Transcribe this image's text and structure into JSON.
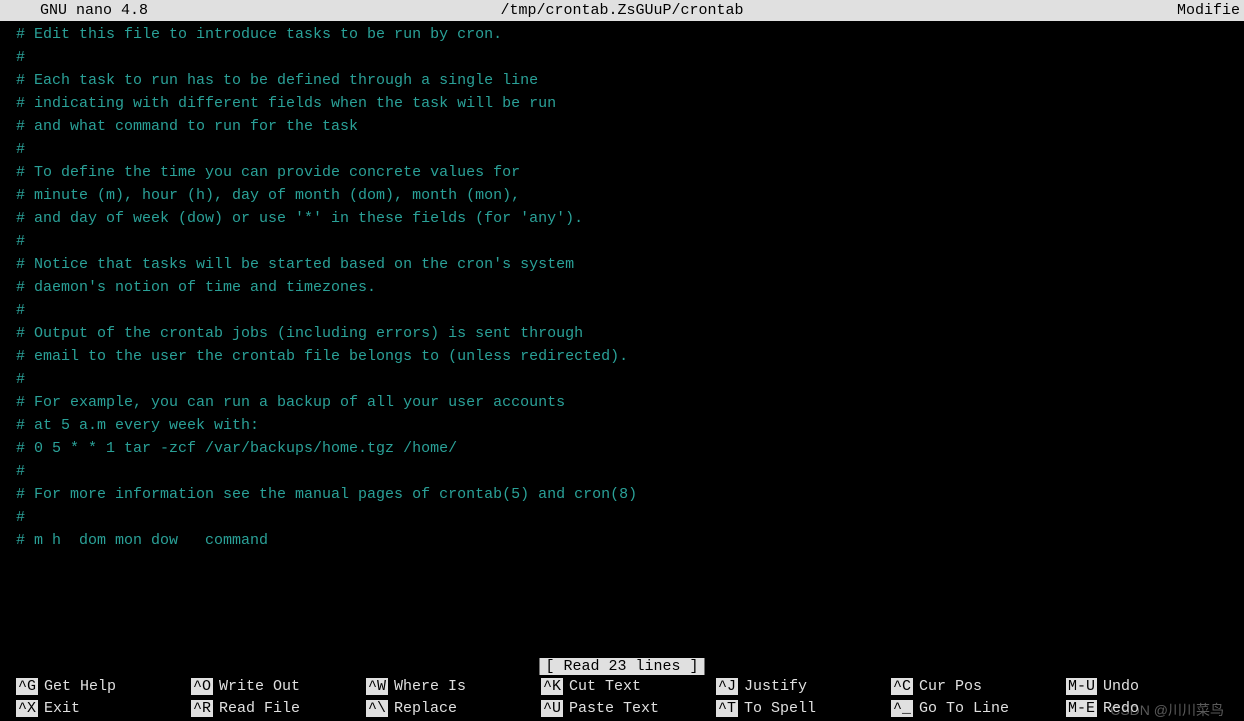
{
  "titlebar": {
    "app": "GNU nano 4.8",
    "filepath": "/tmp/crontab.ZsGUuP/crontab",
    "status": "Modifie"
  },
  "content": [
    "# Edit this file to introduce tasks to be run by cron.",
    "#",
    "# Each task to run has to be defined through a single line",
    "# indicating with different fields when the task will be run",
    "# and what command to run for the task",
    "#",
    "# To define the time you can provide concrete values for",
    "# minute (m), hour (h), day of month (dom), month (mon),",
    "# and day of week (dow) or use '*' in these fields (for 'any').",
    "#",
    "# Notice that tasks will be started based on the cron's system",
    "# daemon's notion of time and timezones.",
    "#",
    "# Output of the crontab jobs (including errors) is sent through",
    "# email to the user the crontab file belongs to (unless redirected).",
    "#",
    "# For example, you can run a backup of all your user accounts",
    "# at 5 a.m every week with:",
    "# 0 5 * * 1 tar -zcf /var/backups/home.tgz /home/",
    "#",
    "# For more information see the manual pages of crontab(5) and cron(8)",
    "#",
    "# m h  dom mon dow   command"
  ],
  "status_message": "[ Read 23 lines ]",
  "menu": {
    "row1": [
      {
        "key": "^G",
        "label": "Get Help"
      },
      {
        "key": "^O",
        "label": "Write Out"
      },
      {
        "key": "^W",
        "label": "Where Is"
      },
      {
        "key": "^K",
        "label": "Cut Text"
      },
      {
        "key": "^J",
        "label": "Justify"
      },
      {
        "key": "^C",
        "label": "Cur Pos"
      },
      {
        "key": "M-U",
        "label": "Undo"
      }
    ],
    "row2": [
      {
        "key": "^X",
        "label": "Exit"
      },
      {
        "key": "^R",
        "label": "Read File"
      },
      {
        "key": "^\\",
        "label": "Replace"
      },
      {
        "key": "^U",
        "label": "Paste Text"
      },
      {
        "key": "^T",
        "label": "To Spell"
      },
      {
        "key": "^_",
        "label": "Go To Line"
      },
      {
        "key": "M-E",
        "label": "Redo"
      }
    ]
  },
  "watermark": "CSDN @川川菜鸟"
}
